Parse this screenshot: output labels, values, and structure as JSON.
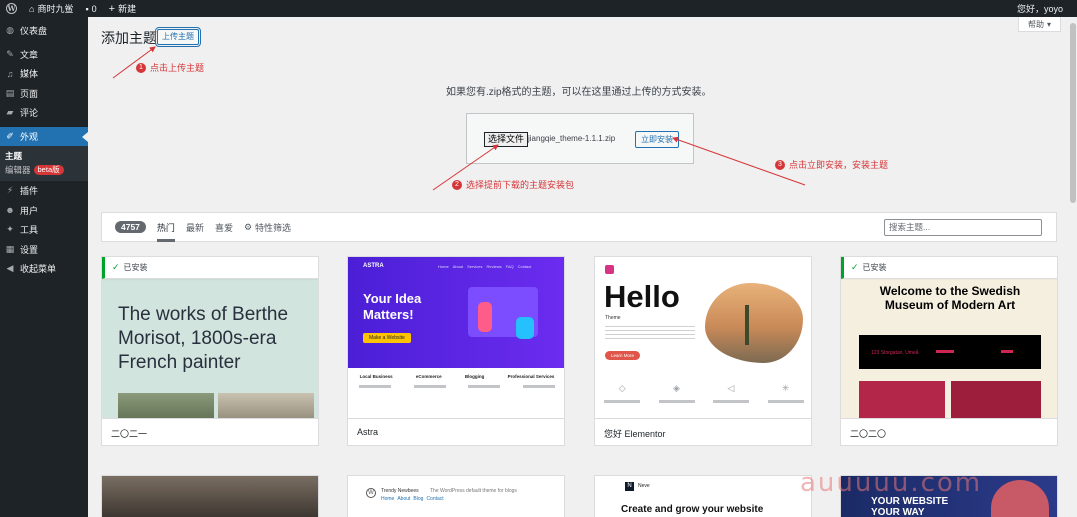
{
  "adminbar": {
    "site_name": "商时九鲎",
    "comments": "0",
    "new": "新建",
    "greeting": "您好，yoyo"
  },
  "sidebar": {
    "items": [
      {
        "label": "仪表盘",
        "icon": "dashboard-icon"
      },
      {
        "label": "文章",
        "icon": "pin-icon"
      },
      {
        "label": "媒体",
        "icon": "media-icon"
      },
      {
        "label": "页面",
        "icon": "page-icon"
      },
      {
        "label": "评论",
        "icon": "comment-icon"
      },
      {
        "label": "外观",
        "icon": "brush-icon"
      },
      {
        "label": "插件",
        "icon": "plugin-icon"
      },
      {
        "label": "用户",
        "icon": "user-icon"
      },
      {
        "label": "工具",
        "icon": "wrench-icon"
      },
      {
        "label": "设置",
        "icon": "settings-icon"
      },
      {
        "label": "收起菜单",
        "icon": "collapse-icon"
      }
    ],
    "submenu": [
      {
        "label": "主题"
      },
      {
        "label": "编辑器",
        "badge": "beta版"
      }
    ]
  },
  "header": {
    "title": "添加主题",
    "upload_label": "上传主题",
    "help_label": "帮助"
  },
  "annotations": [
    {
      "num": "1",
      "text": "点击上传主题"
    },
    {
      "num": "2",
      "text": "选择提前下载的主题安装包"
    },
    {
      "num": "3",
      "text": "点击立即安装，安装主题"
    }
  ],
  "upload": {
    "description": "如果您有.zip格式的主题，可以在这里通过上传的方式安装。",
    "choose_label": "选择文件",
    "file_name": "jiangqie_theme-1.1.1.zip",
    "install_label": "立即安装"
  },
  "filter": {
    "count": "4757",
    "tabs": [
      "热门",
      "最新",
      "喜爱"
    ],
    "feature_filter": "特性筛选",
    "search_placeholder": "搜索主题..."
  },
  "themes": [
    {
      "name": "二〇二一",
      "installed": "已安装",
      "headline": "The works of Berthe Morisot, 1800s-era French painter"
    },
    {
      "name": "Astra",
      "brand": "ASTRA",
      "nav": [
        "Home",
        "About",
        "Services",
        "Reviews",
        "FAQ",
        "Contact"
      ],
      "headline": "Your Idea Matters!",
      "cta": "Make a Website",
      "features": [
        "Local Business",
        "eCommerce",
        "Blogging",
        "Professional Services"
      ]
    },
    {
      "name": "您好 Elementor",
      "headline": "Hello",
      "sub": "Theme",
      "cta": "Learn More"
    },
    {
      "name": "二〇二〇",
      "installed": "已安装",
      "headline": "Welcome to the Swedish Museum of Modern Art",
      "address": "123 Storgatan, Umeå"
    },
    {
      "name": "",
      "headline": ""
    },
    {
      "name": "",
      "site": "Trendy Newbees",
      "tagline": "The WordPress default theme for blogs",
      "nav": [
        "Home",
        "About",
        "Blog",
        "Contact"
      ]
    },
    {
      "name": "",
      "brand": "Neve",
      "headline": "Create and grow your website"
    },
    {
      "name": "",
      "headline": "YOUR WEBSITE YOUR WAY"
    }
  ],
  "watermark": "auuuuu.com"
}
